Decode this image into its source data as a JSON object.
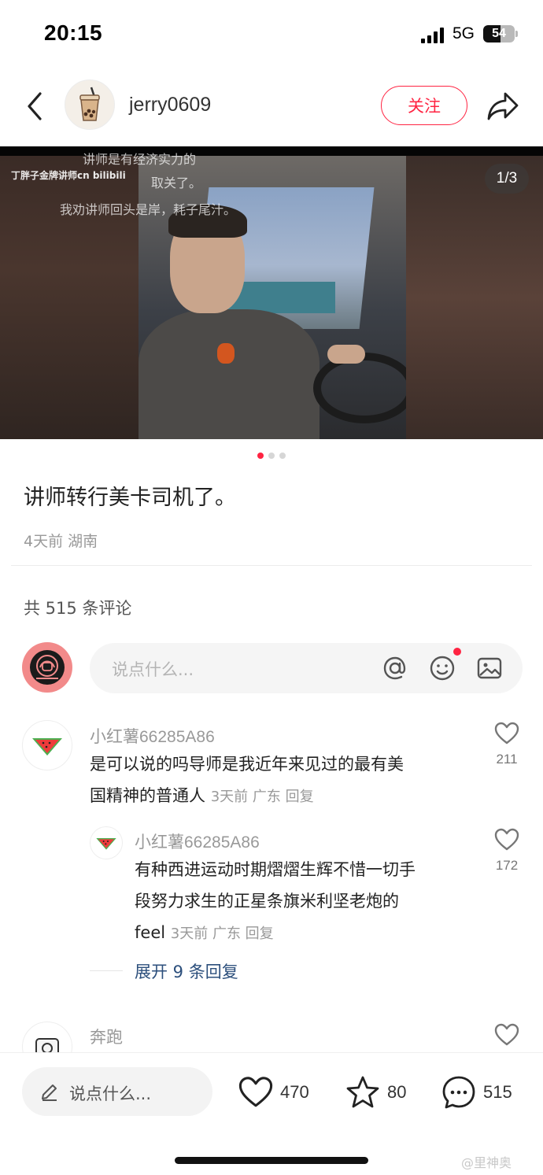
{
  "status": {
    "time": "20:15",
    "network": "5G",
    "battery": "54",
    "battery_level": 0.54
  },
  "header": {
    "author": "jerry0609",
    "follow_label": "关注"
  },
  "media": {
    "page_indicator": "1/3",
    "overlay_lines": [
      "讲师是有经济实力的",
      "取关了。",
      "我劝讲师回头是岸，耗子尾汁。"
    ],
    "watermark": "丁胖子金牌讲师cn bilibili",
    "total_pages": 3,
    "current_page": 1
  },
  "post": {
    "title": "讲师转行美卡司机了。",
    "meta": "4天前 湖南"
  },
  "comments_header": {
    "count_text": "共 515 条评论"
  },
  "comment_input": {
    "placeholder": "说点什么..."
  },
  "comments": [
    {
      "user": "小红薯66285A86",
      "text_line1": "是可以说的吗导师是我近年来见过的最有美",
      "text_line2": "国精神的普通人",
      "meta": "3天前 广东 回复",
      "likes": "211",
      "reply": {
        "user": "小红薯66285A86",
        "text_line1": "有种西进运动时期熠熠生辉不惜一切手",
        "text_line2": "段努力求生的正星条旗米利坚老炮的",
        "text_line3": "feel",
        "meta": "3天前 广东 回复",
        "likes": "172"
      },
      "expand_text": "展开 9 条回复"
    },
    {
      "user": "奔跑"
    }
  ],
  "bottom_bar": {
    "input_placeholder": "说点什么...",
    "likes": "470",
    "stars": "80",
    "comments": "515"
  },
  "watermark_corner": "@里神奥"
}
